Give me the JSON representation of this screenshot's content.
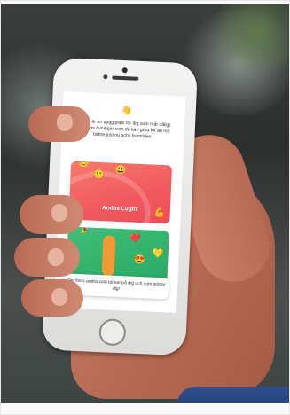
{
  "app_screen": {
    "intro_text": "Det här är en trygg plats för dig som mår dåligt. Här finns övningar som du kan göra för att må bättre just nu och i framtiden.",
    "card_primary_title": "Andas Lugnt",
    "caption_text": "Det finns andra som tänker på dig och som stöttar dig!"
  },
  "colors": {
    "card_primary": "#f0595f",
    "card_secondary": "#2aa866",
    "phone_body": "#e8e8e6",
    "skin": "#b86c55",
    "sleeve": "#2d4f8e"
  },
  "icons": [
    "hand-wave-emoji",
    "smiley-emoji",
    "flexed-biceps-emoji",
    "heart-emoji",
    "heart-eyes-emoji",
    "party-popper-emoji"
  ]
}
